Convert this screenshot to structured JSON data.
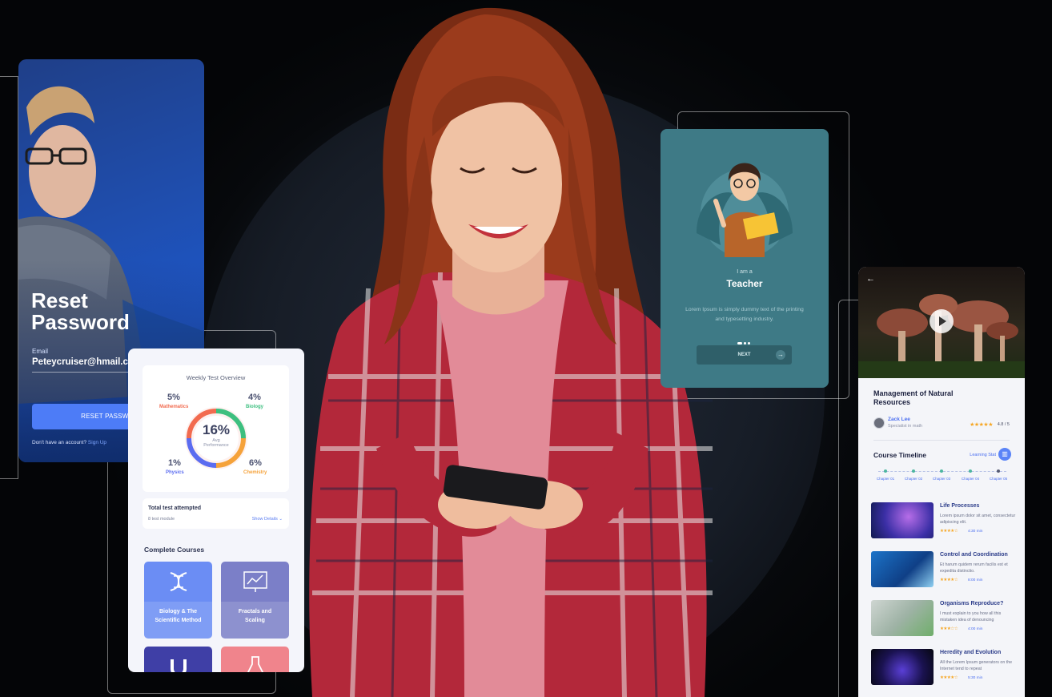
{
  "reset_password": {
    "title": "Reset\nPassword",
    "email_label": "Email",
    "email_value": "Peteycruiser@hmail.com",
    "button_label": "RESET PASSWORD",
    "signup_prompt": "Don't have an account?",
    "signup_link": "Sign Up"
  },
  "weekly_test": {
    "title": "Weekly Test Overview",
    "subjects": [
      {
        "percent": "5%",
        "label": "Mathematics",
        "color": "#f26b4f"
      },
      {
        "percent": "4%",
        "label": "Biology",
        "color": "#3dbf7f"
      },
      {
        "percent": "1%",
        "label": "Physics",
        "color": "#5b6cf0"
      },
      {
        "percent": "6%",
        "label": "Chemistry",
        "color": "#f5a23a"
      }
    ],
    "average_value": "16%",
    "average_label": "Avg\nPerformance",
    "total_title": "Total test attempted",
    "total_sub": "8 test module",
    "show_details": "Show Details"
  },
  "complete_courses": {
    "title": "Complete Courses",
    "tiles": [
      {
        "label": "Biology & The\nScientific Method",
        "color": "#6b8df4",
        "icon": "dna-icon"
      },
      {
        "label": "Fractals and\nScaling",
        "color": "#7b7fc8",
        "icon": "chart-board-icon"
      },
      {
        "label": "",
        "color": "#3f3fa6",
        "icon": "magnet-icon"
      },
      {
        "label": "",
        "color": "#f0848c",
        "icon": "flask-icon"
      }
    ]
  },
  "onboarding": {
    "intro": "I am a",
    "role": "Teacher",
    "description": "Lorem Ipsum is simply dummy text of the printing and typesetting industry.",
    "next_label": "NEXT"
  },
  "course_detail": {
    "title": "Management of Natural\nResources",
    "instructor": "Zack Lee",
    "instructor_role": "Specialist in math",
    "stars": "★★★★★",
    "rating": "4.8 / 5",
    "timeline_title": "Course Timeline",
    "learning_stat": "Learning Stat",
    "chapters": [
      "Chapter 01",
      "Chapter 02",
      "Chapter 03",
      "Chapter 04",
      "Chapter 05"
    ],
    "lessons": [
      {
        "title": "Life Processes",
        "desc": "Lorem ipsum dolor sit amet, consectetur adipiscing elit.",
        "stars": "★★★★☆",
        "duration": "4:30 min"
      },
      {
        "title": "Control and Coordination",
        "desc": "Et harum quidem rerum facilis est et expedita distinctio.",
        "stars": "★★★★☆",
        "duration": "8:00 min"
      },
      {
        "title": "Organisms Reproduce?",
        "desc": "I must explain to you how all this mistaken idea of denouncing",
        "stars": "★★★☆☆",
        "duration": "4:00 min"
      },
      {
        "title": "Heredity and Evolution",
        "desc": "All the Lorem Ipsum generators on the Internet tend to repeat",
        "stars": "★★★★☆",
        "duration": "5:30 min"
      }
    ]
  }
}
